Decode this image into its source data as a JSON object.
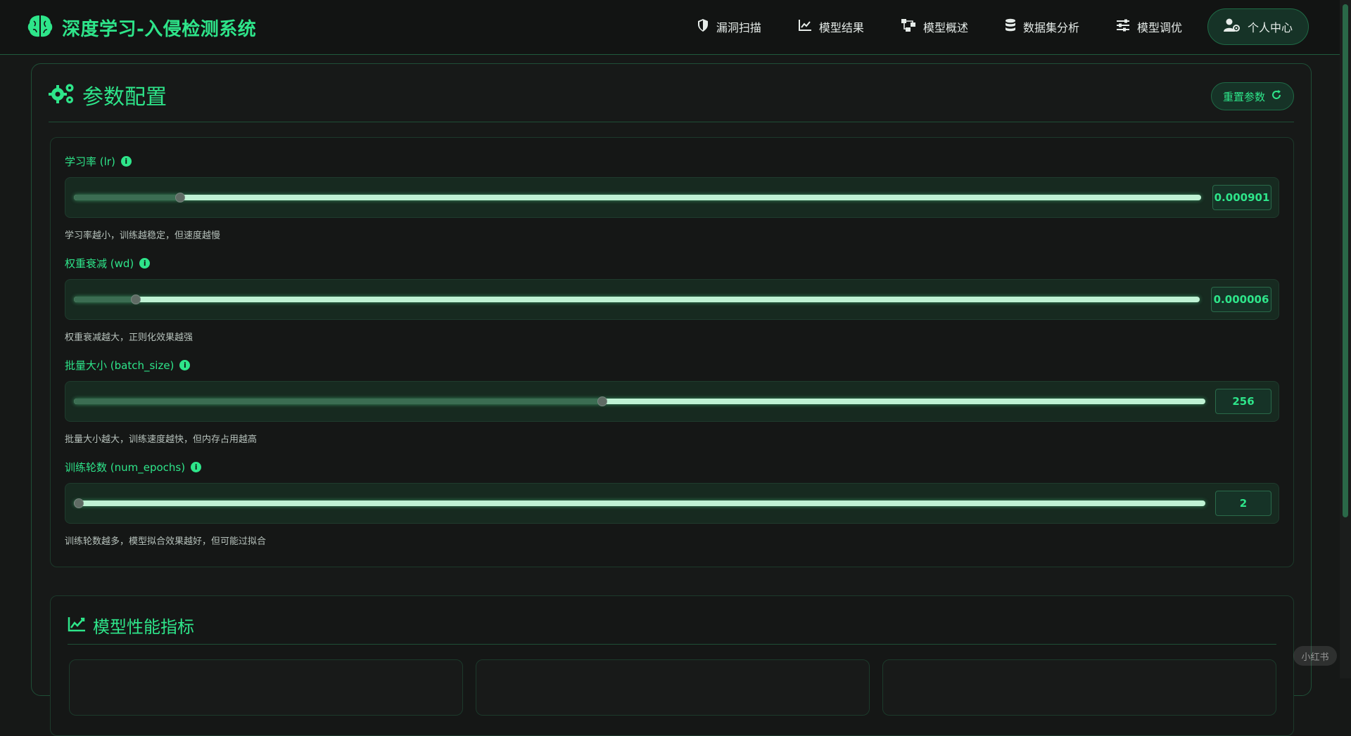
{
  "brand": {
    "title": "深度学习-入侵检测系统",
    "icon": "brain-icon",
    "color": "#2ee58a"
  },
  "nav": {
    "items": [
      {
        "label": "漏洞扫描",
        "icon": "shield-icon"
      },
      {
        "label": "模型结果",
        "icon": "line-chart-icon"
      },
      {
        "label": "模型概述",
        "icon": "sitemap-icon"
      },
      {
        "label": "数据集分析",
        "icon": "database-icon"
      },
      {
        "label": "模型调优",
        "icon": "sliders-icon"
      }
    ],
    "user": {
      "label": "个人中心",
      "icon": "user-gear-icon"
    }
  },
  "config": {
    "title": "参数配置",
    "icon": "gears-icon",
    "reset_label": "重置参数",
    "reset_icon": "refresh-icon",
    "params": [
      {
        "label": "学习率 (lr)",
        "value": "0.000901",
        "help": "学习率越小，训练越稳定，但速度越慢",
        "fill_fraction": 0.094
      },
      {
        "label": "权重衰减 (wd)",
        "value": "0.000006",
        "help": "权重衰减越大，正则化效果越强",
        "fill_fraction": 0.055
      },
      {
        "label": "批量大小 (batch_size)",
        "value": "256",
        "help": "批量大小越大，训练速度越快，但内存占用越高",
        "fill_fraction": 0.467
      },
      {
        "label": "训练轮数 (num_epochs)",
        "value": "2",
        "help": "训练轮数越多，模型拟合效果越好，但可能过拟合",
        "fill_fraction": 0.0
      }
    ]
  },
  "performance": {
    "title": "模型性能指标",
    "icon": "area-chart-icon"
  },
  "watermark": "小红书"
}
